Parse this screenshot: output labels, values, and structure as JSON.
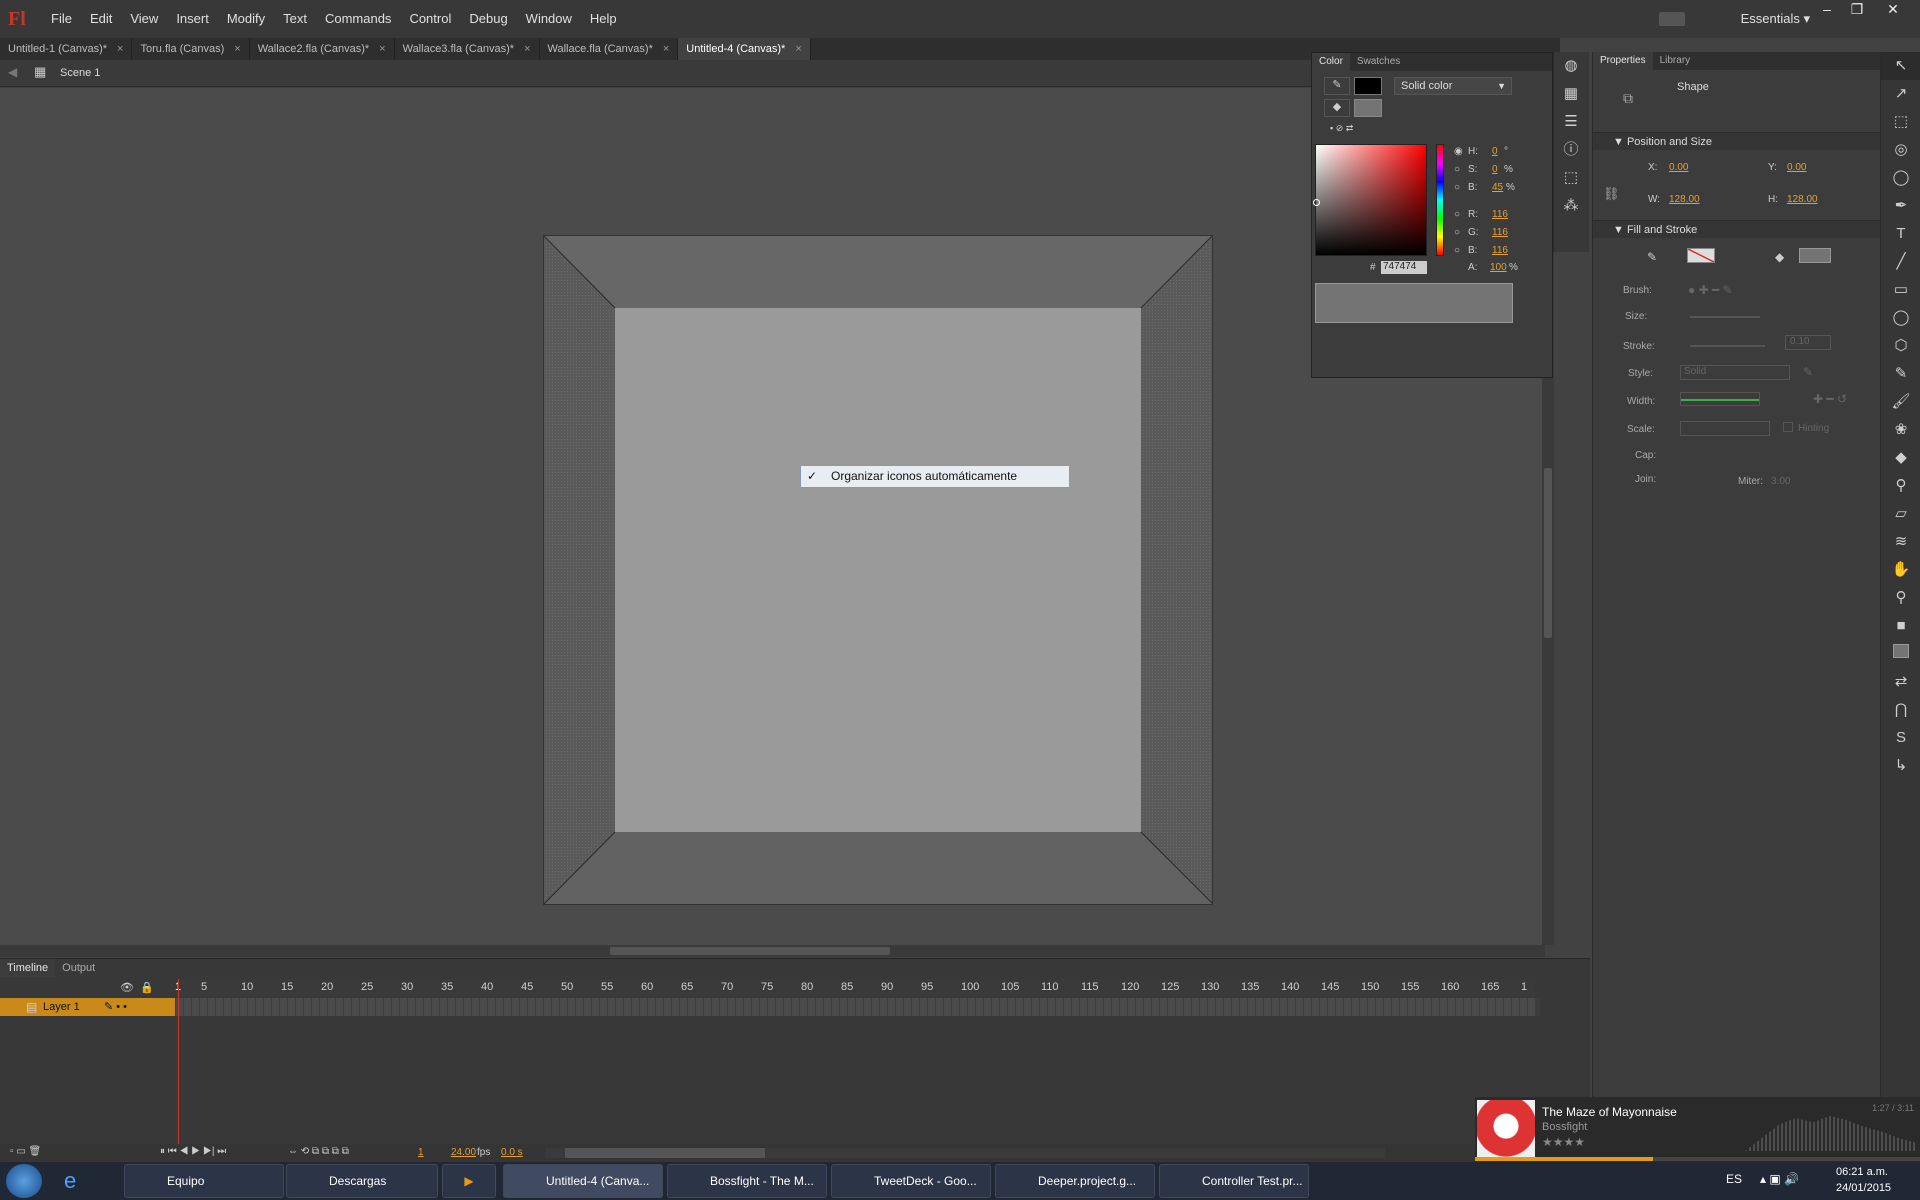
{
  "app": {
    "logo": "Fl",
    "workspace": "Essentials"
  },
  "menu": [
    "File",
    "Edit",
    "View",
    "Insert",
    "Modify",
    "Text",
    "Commands",
    "Control",
    "Debug",
    "Window",
    "Help"
  ],
  "tabs": [
    {
      "label": "Untitled-1 (Canvas)*",
      "active": false
    },
    {
      "label": "Toru.fla (Canvas)",
      "active": false
    },
    {
      "label": "Wallace2.fla (Canvas)*",
      "active": false
    },
    {
      "label": "Wallace3.fla (Canvas)*",
      "active": false
    },
    {
      "label": "Wallace.fla (Canvas)*",
      "active": false
    },
    {
      "label": "Untitled-4 (Canvas)*",
      "active": true
    }
  ],
  "scene": {
    "label": "Scene 1"
  },
  "context_menu": {
    "check": "✓",
    "label": "Organizar iconos automáticamente"
  },
  "color_panel": {
    "tab_color": "Color",
    "tab_swatches": "Swatches",
    "fill_type": "Solid color",
    "H": {
      "label": "H:",
      "value": "0",
      "unit": "°"
    },
    "S": {
      "label": "S:",
      "value": "0",
      "unit": "%"
    },
    "Bh": {
      "label": "B:",
      "value": "45",
      "unit": "%"
    },
    "R": {
      "label": "R:",
      "value": "116"
    },
    "G": {
      "label": "G:",
      "value": "116"
    },
    "Bc": {
      "label": "B:",
      "value": "116"
    },
    "hex_label": "#",
    "hex": "747474",
    "A": {
      "label": "A:",
      "value": "100",
      "unit": "%"
    },
    "fill_color": "#747474"
  },
  "properties": {
    "tab_properties": "Properties",
    "tab_library": "Library",
    "object": "Shape",
    "pos_section": "Position and Size",
    "x_label": "X:",
    "x": "0.00",
    "y_label": "Y:",
    "y": "0.00",
    "w_label": "W:",
    "w": "128.00",
    "h_label": "H:",
    "h": "128.00",
    "fill_section": "Fill and Stroke",
    "brush_label": "Brush:",
    "size_label": "Size:",
    "stroke_label": "Stroke:",
    "stroke": "0.10",
    "style_label": "Style:",
    "style": "Solid",
    "width_label": "Width:",
    "scale_label": "Scale:",
    "hinting": "Hinting",
    "cap_label": "Cap:",
    "join_label": "Join:",
    "miter_label": "Miter:",
    "miter": "3.00"
  },
  "timeline": {
    "tab_timeline": "Timeline",
    "tab_output": "Output",
    "layer": "Layer 1",
    "ruler": [
      "1",
      "5",
      "10",
      "15",
      "20",
      "25",
      "30",
      "35",
      "40",
      "45",
      "50",
      "55",
      "60",
      "65",
      "70",
      "75",
      "80",
      "85",
      "90",
      "95",
      "100",
      "105",
      "110",
      "115",
      "120",
      "125",
      "130",
      "135",
      "140",
      "145",
      "150",
      "155",
      "160",
      "165",
      "1"
    ],
    "frame": "1",
    "fps": "24.00",
    "fps_unit": "fps",
    "time": "0.0 s"
  },
  "music": {
    "title": "The Maze of Mayonnaise",
    "artist": "Bossfight",
    "time": "1:27 / 3:11"
  },
  "taskbar": {
    "items": [
      "Equipo",
      "Descargas",
      "",
      "Untitled-4 (Canva...",
      "Bossfight - The M...",
      "TweetDeck - Goo...",
      "Deeper.project.g...",
      "Controller Test.pr..."
    ],
    "lang": "ES",
    "clock": "06:21 a.m.",
    "date": "24/01/2015"
  }
}
